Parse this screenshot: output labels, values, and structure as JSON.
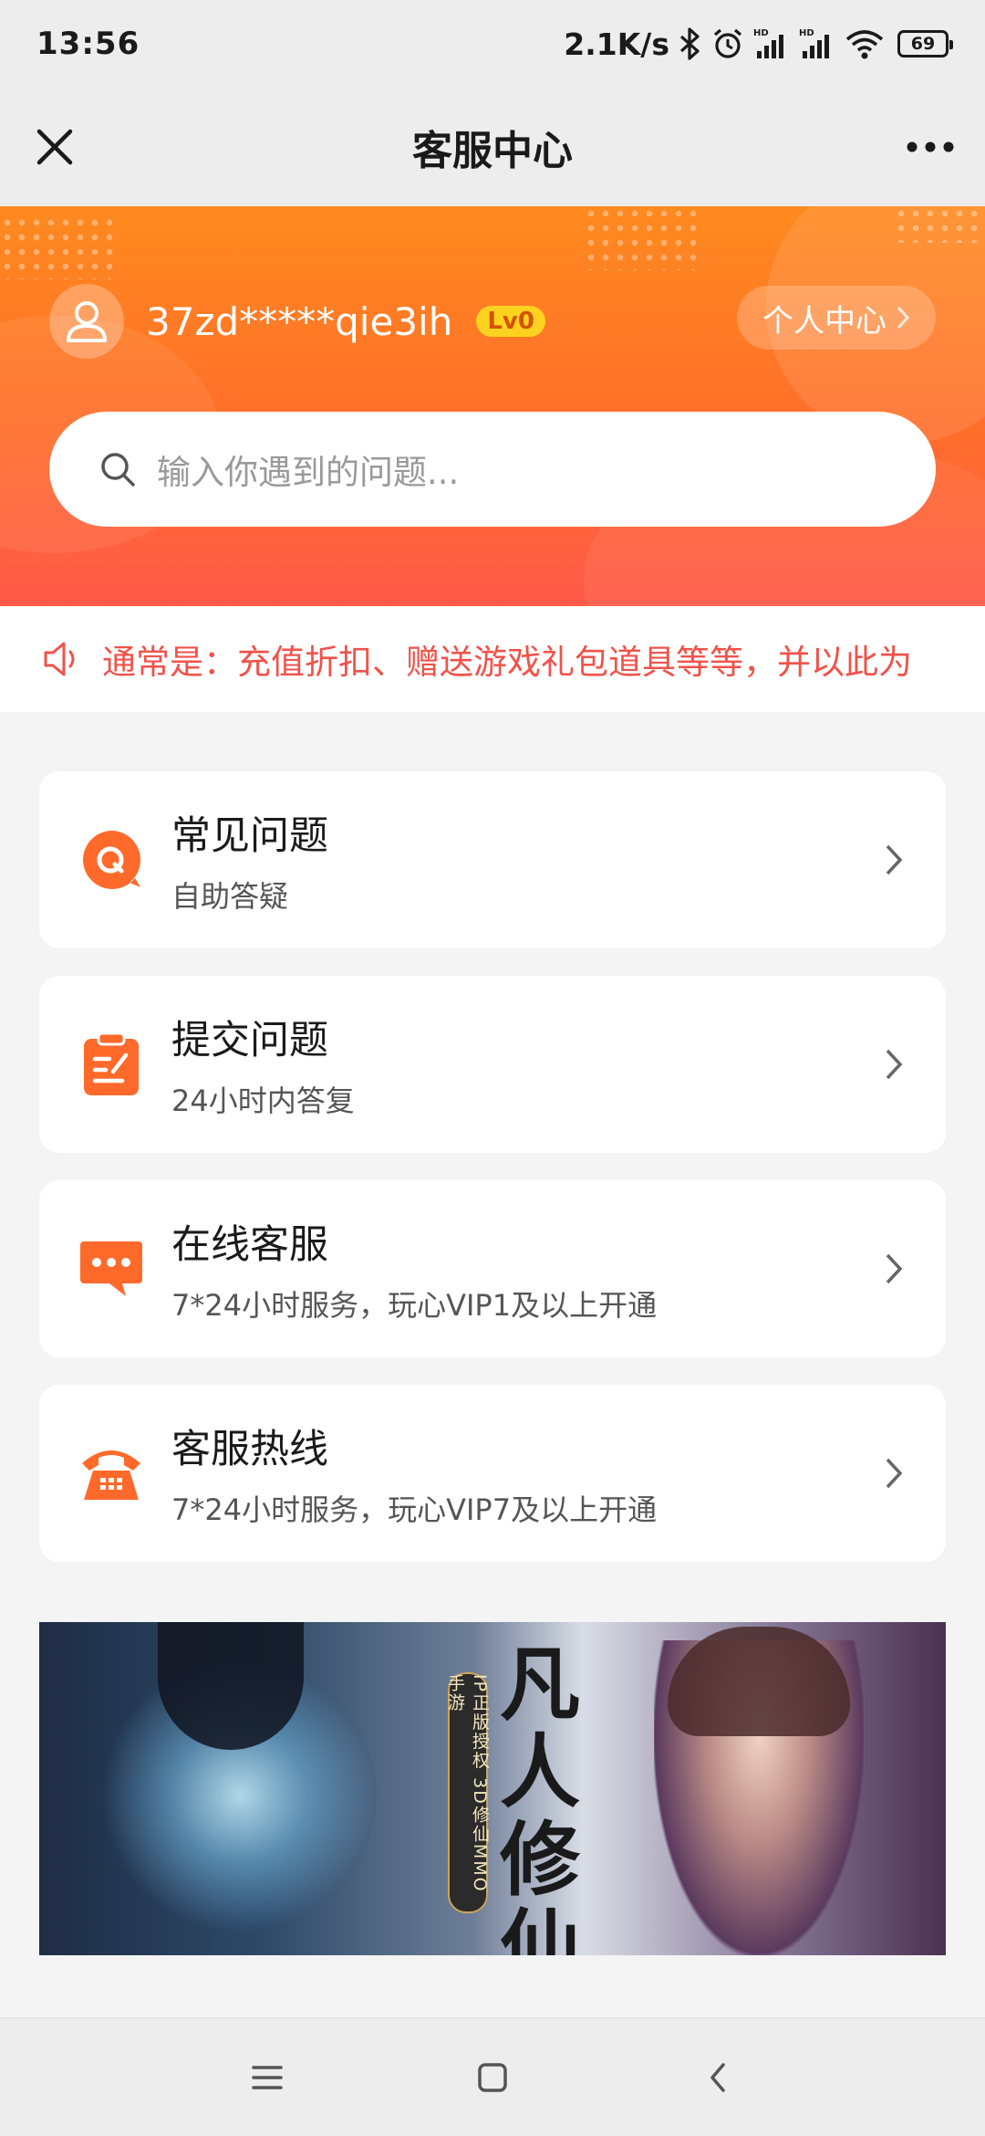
{
  "status_bar": {
    "time": "13:56",
    "net_speed": "2.1K/s",
    "battery": "69",
    "icons": [
      "bluetooth-icon",
      "alarm-icon",
      "signal-hd-icon",
      "signal-hd-icon",
      "wifi-icon",
      "battery-icon"
    ]
  },
  "header": {
    "title": "客服中心",
    "close_icon": "close-icon",
    "more_icon": "more-icon"
  },
  "profile": {
    "username": "37zd*****qie3ih",
    "level": "Lv0",
    "center_label": "个人中心"
  },
  "search": {
    "placeholder": "输入你遇到的问题..."
  },
  "notice": {
    "text": "通常是：充值折扣、赠送游戏礼包道具等等，并以此为"
  },
  "menu": [
    {
      "title": "常见问题",
      "subtitle": "自助答疑",
      "icon": "faq-icon"
    },
    {
      "title": "提交问题",
      "subtitle": "24小时内答复",
      "icon": "submit-icon"
    },
    {
      "title": "在线客服",
      "subtitle": "7*24小时服务，玩心VIP1及以上开通",
      "icon": "chat-icon"
    },
    {
      "title": "客服热线",
      "subtitle": "7*24小时服务，玩心VIP7及以上开通",
      "icon": "phone-icon"
    }
  ],
  "banner": {
    "tag": "IP正版授权 3D修仙MMO手游",
    "title": "凡人修仙传"
  },
  "colors": {
    "accent": "#ff7a2a",
    "notice": "#f0524a",
    "level_badge": "#ffd21f"
  },
  "nav": {
    "icons": [
      "menu-icon",
      "home-icon",
      "back-icon"
    ]
  }
}
